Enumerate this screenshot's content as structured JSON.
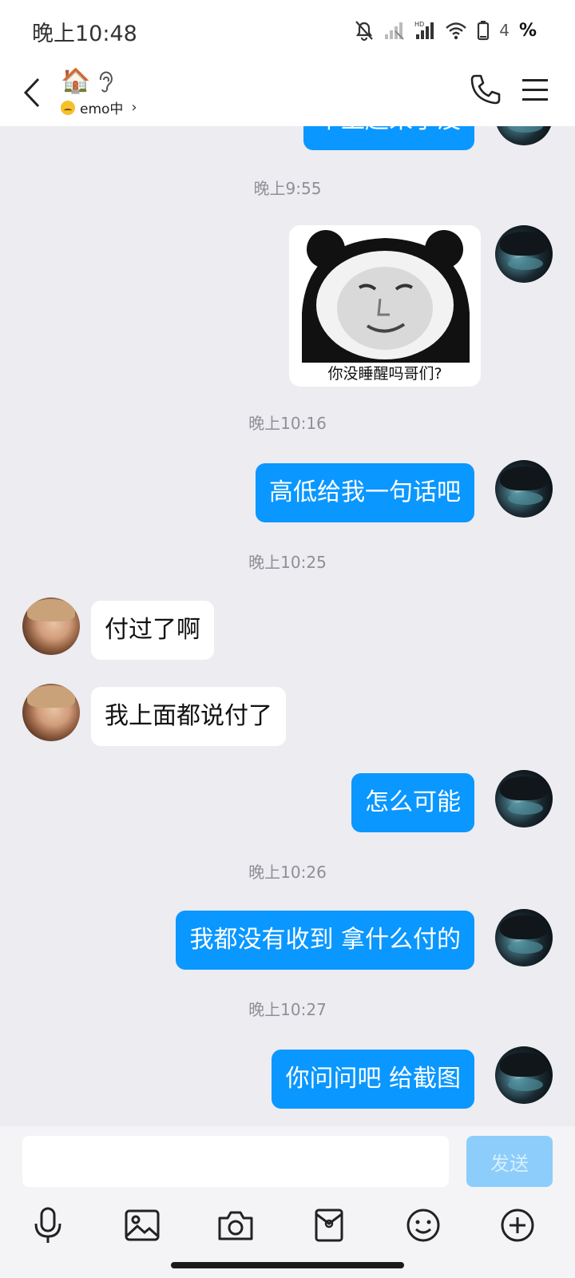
{
  "status_bar": {
    "time": "晚上10:48",
    "battery_level": "4",
    "battery_symbol": "%"
  },
  "header": {
    "title_emoji": "🏠",
    "status_text": "emo中",
    "status_chevron": "›"
  },
  "messages": [
    {
      "type": "text",
      "from": "me",
      "text": "早上起来了没"
    },
    {
      "type": "time",
      "text": "晚上9:55"
    },
    {
      "type": "sticker",
      "from": "me",
      "caption": "你没睡醒吗哥们?"
    },
    {
      "type": "time",
      "text": "晚上10:16"
    },
    {
      "type": "text",
      "from": "me",
      "text": "高低给我一句话吧"
    },
    {
      "type": "time",
      "text": "晚上10:25"
    },
    {
      "type": "text",
      "from": "them",
      "text": "付过了啊"
    },
    {
      "type": "text",
      "from": "them",
      "text": "我上面都说付了"
    },
    {
      "type": "text",
      "from": "me",
      "text": "怎么可能"
    },
    {
      "type": "time",
      "text": "晚上10:26"
    },
    {
      "type": "text",
      "from": "me",
      "text": "我都没有收到 拿什么付的"
    },
    {
      "type": "time",
      "text": "晚上10:27"
    },
    {
      "type": "text",
      "from": "me",
      "text": "你问问吧 给截图"
    }
  ],
  "input": {
    "value": "",
    "placeholder": "",
    "send_label": "发送"
  },
  "toolbar": [
    "microphone-icon",
    "image-icon",
    "camera-icon",
    "red-packet-icon",
    "emoji-icon",
    "plus-icon"
  ],
  "colors": {
    "my_bubble": "#0a97ff",
    "their_bubble": "#ffffff",
    "background": "#ececf1",
    "send_disabled": "#8ccdfb"
  }
}
